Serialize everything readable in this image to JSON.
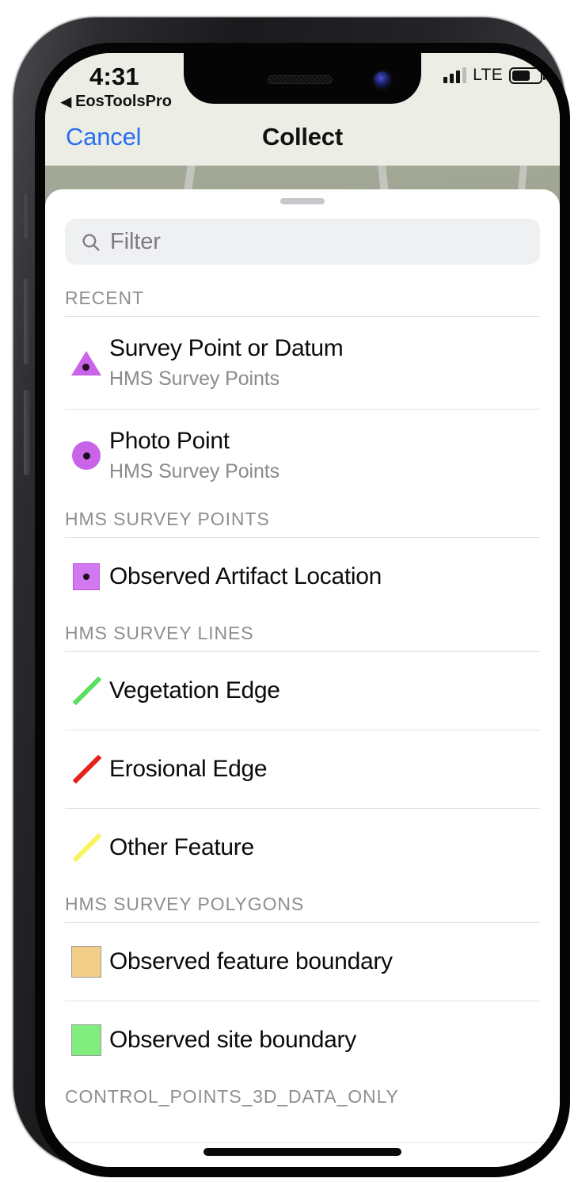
{
  "status_bar": {
    "time": "4:31",
    "back_app_label": "EosToolsPro",
    "back_arrow_icon": "◀",
    "network_type": "LTE",
    "signal_icon": "signal-bars-icon",
    "battery_icon": "battery-icon",
    "battery_level_pct": 66
  },
  "nav_bar": {
    "cancel_label": "Cancel",
    "title": "Collect"
  },
  "sheet": {
    "grabber": "sheet-grabber",
    "search": {
      "icon": "search-icon",
      "placeholder": "Filter",
      "value": ""
    }
  },
  "sections": [
    {
      "header": "RECENT",
      "items": [
        {
          "title": "Survey Point or Datum",
          "subtitle": "HMS Survey Points",
          "symbol": "triangle-point-symbol",
          "color": "#c964e8"
        },
        {
          "title": "Photo Point",
          "subtitle": "HMS Survey Points",
          "symbol": "circle-point-symbol",
          "color": "#c964e8"
        }
      ]
    },
    {
      "header": "HMS SURVEY POINTS",
      "items": [
        {
          "title": "Observed Artifact Location",
          "subtitle": "",
          "symbol": "square-point-symbol",
          "color": "#d278f0"
        }
      ]
    },
    {
      "header": "HMS SURVEY LINES",
      "items": [
        {
          "title": "Vegetation Edge",
          "subtitle": "",
          "symbol": "line-symbol",
          "color": "#5ce061"
        },
        {
          "title": "Erosional Edge",
          "subtitle": "",
          "symbol": "line-symbol",
          "color": "#e8201c"
        },
        {
          "title": "Other Feature",
          "subtitle": "",
          "symbol": "line-symbol",
          "color": "#f7f45c"
        }
      ]
    },
    {
      "header": "HMS SURVEY POLYGONS",
      "items": [
        {
          "title": "Observed feature boundary",
          "subtitle": "",
          "symbol": "polygon-swatch-symbol",
          "color": "#f2cd87"
        },
        {
          "title": "Observed site boundary",
          "subtitle": "",
          "symbol": "polygon-swatch-symbol",
          "color": "#81ed7e"
        }
      ]
    },
    {
      "header": "CONTROL_POINTS_3D_DATA_ONLY",
      "items": []
    }
  ],
  "home_indicator": "home-indicator"
}
